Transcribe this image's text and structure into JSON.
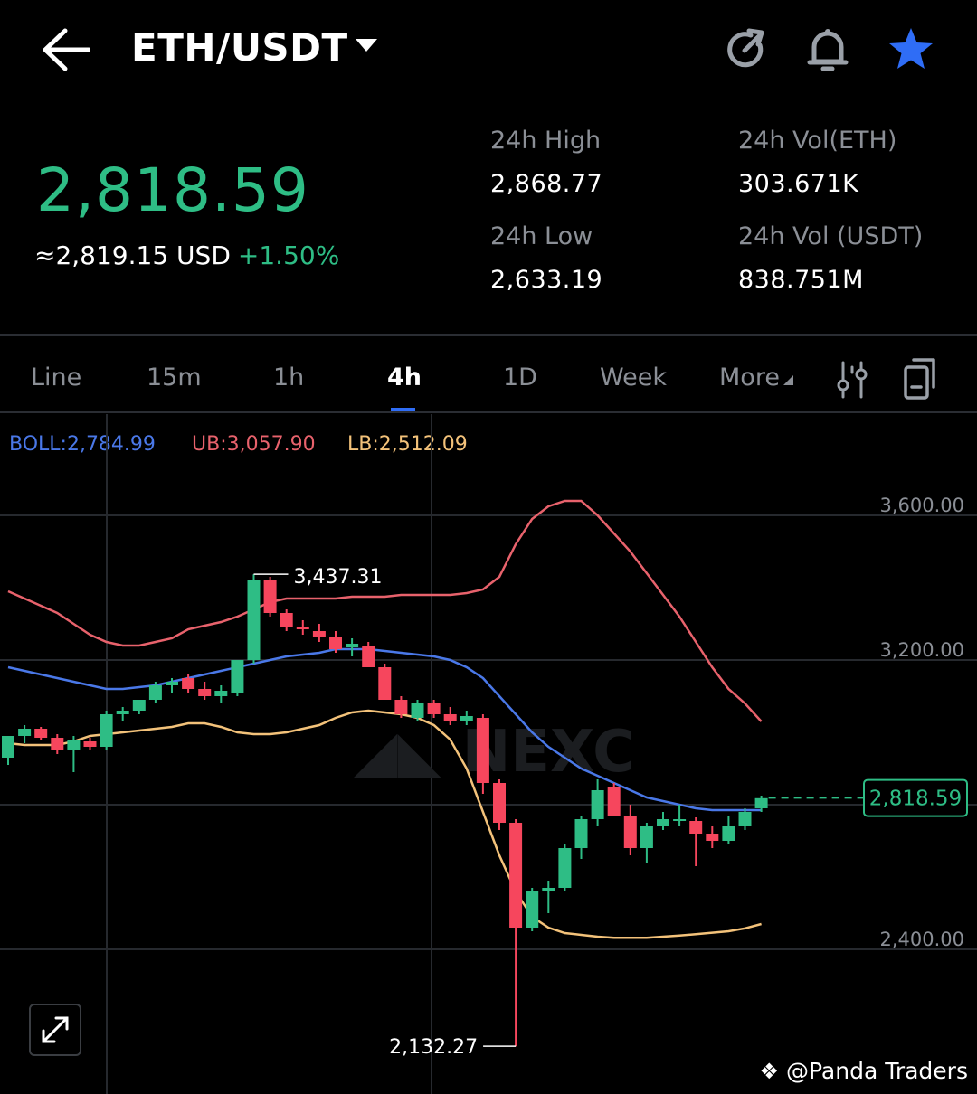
{
  "header": {
    "pair": "ETH/USDT",
    "icons": [
      "back-arrow-icon",
      "refresh-share-icon",
      "bell-icon",
      "star-icon"
    ],
    "star_color": "#2f6df6"
  },
  "ticker": {
    "last_price": "2,818.59",
    "usd_equiv": "≈2,819.15 USD",
    "change_pct": "+1.50%",
    "high_label": "24h High",
    "high_value": "2,868.77",
    "low_label": "24h Low",
    "low_value": "2,633.19",
    "vol_eth_label": "24h Vol(ETH)",
    "vol_eth_value": "303.671K",
    "vol_usdt_label": "24h Vol (USDT)",
    "vol_usdt_value": "838.751M",
    "up_color": "#2ebd85",
    "down_color": "#f6465d"
  },
  "tabs": {
    "items": [
      "Line",
      "15m",
      "1h",
      "4h",
      "1D",
      "Week",
      "More"
    ],
    "active": "4h"
  },
  "indicators": {
    "boll": "BOLL:2,784.99",
    "ub": "UB:3,057.90",
    "lb": "LB:2,512.09",
    "boll_color": "#4a78e8",
    "ub_color": "#e8626c",
    "lb_color": "#f3c27a"
  },
  "chart_data": {
    "type": "candlestick",
    "y_ticks": [
      "3,600.00",
      "3,200.00",
      "2,400.00"
    ],
    "ylim": [
      2100,
      3700
    ],
    "last_price_label": "2,818.59",
    "last_price": 2818.59,
    "high_label": "3,437.31",
    "high_value": 3437.31,
    "low_label": "2,132.27",
    "low_value": 2132.27,
    "candles": [
      [
        2930,
        2990,
        2910,
        2990
      ],
      [
        2990,
        3020,
        2970,
        3010
      ],
      [
        3010,
        3015,
        2980,
        2985
      ],
      [
        2985,
        2995,
        2940,
        2950
      ],
      [
        2950,
        2990,
        2890,
        2980
      ],
      [
        2975,
        2985,
        2950,
        2960
      ],
      [
        2960,
        3060,
        2950,
        3050
      ],
      [
        3050,
        3070,
        3030,
        3060
      ],
      [
        3060,
        3090,
        3050,
        3090
      ],
      [
        3090,
        3140,
        3080,
        3130
      ],
      [
        3130,
        3150,
        3110,
        3140
      ],
      [
        3150,
        3160,
        3110,
        3120
      ],
      [
        3120,
        3140,
        3090,
        3100
      ],
      [
        3100,
        3130,
        3080,
        3115
      ],
      [
        3110,
        3200,
        3100,
        3200
      ],
      [
        3200,
        3437,
        3190,
        3420
      ],
      [
        3420,
        3430,
        3320,
        3330
      ],
      [
        3330,
        3340,
        3280,
        3290
      ],
      [
        3290,
        3310,
        3270,
        3285
      ],
      [
        3280,
        3300,
        3250,
        3265
      ],
      [
        3265,
        3280,
        3220,
        3230
      ],
      [
        3235,
        3260,
        3210,
        3245
      ],
      [
        3240,
        3250,
        3180,
        3180
      ],
      [
        3180,
        3190,
        3090,
        3090
      ],
      [
        3090,
        3100,
        3040,
        3050
      ],
      [
        3040,
        3090,
        3030,
        3080
      ],
      [
        3080,
        3090,
        3040,
        3050
      ],
      [
        3050,
        3070,
        3020,
        3030
      ],
      [
        3030,
        3060,
        3020,
        3045
      ],
      [
        3040,
        3050,
        2830,
        2860
      ],
      [
        2860,
        2870,
        2730,
        2750
      ],
      [
        2750,
        2760,
        2132,
        2460
      ],
      [
        2460,
        2570,
        2450,
        2560
      ],
      [
        2560,
        2590,
        2500,
        2570
      ],
      [
        2570,
        2690,
        2560,
        2680
      ],
      [
        2680,
        2770,
        2650,
        2760
      ],
      [
        2760,
        2870,
        2740,
        2840
      ],
      [
        2850,
        2860,
        2770,
        2770
      ],
      [
        2770,
        2800,
        2660,
        2680
      ],
      [
        2680,
        2750,
        2640,
        2740
      ],
      [
        2740,
        2780,
        2730,
        2760
      ],
      [
        2760,
        2800,
        2740,
        2760
      ],
      [
        2755,
        2765,
        2630,
        2720
      ],
      [
        2720,
        2740,
        2680,
        2700
      ],
      [
        2700,
        2770,
        2690,
        2740
      ],
      [
        2740,
        2790,
        2730,
        2780
      ],
      [
        2790,
        2825,
        2780,
        2818
      ]
    ],
    "series": [
      {
        "name": "UB",
        "values": [
          3390,
          3370,
          3350,
          3330,
          3300,
          3270,
          3250,
          3240,
          3240,
          3250,
          3260,
          3285,
          3295,
          3305,
          3320,
          3340,
          3360,
          3370,
          3370,
          3370,
          3370,
          3375,
          3375,
          3375,
          3380,
          3380,
          3380,
          3380,
          3385,
          3395,
          3430,
          3520,
          3590,
          3625,
          3640,
          3640,
          3600,
          3550,
          3500,
          3440,
          3380,
          3320,
          3250,
          3180,
          3120,
          3080,
          3030
        ]
      },
      {
        "name": "BOLL",
        "values": [
          3180,
          3170,
          3160,
          3150,
          3140,
          3130,
          3120,
          3120,
          3125,
          3130,
          3140,
          3150,
          3160,
          3170,
          3180,
          3190,
          3200,
          3210,
          3215,
          3220,
          3230,
          3230,
          3230,
          3225,
          3220,
          3215,
          3210,
          3200,
          3180,
          3150,
          3100,
          3050,
          3000,
          2960,
          2930,
          2900,
          2880,
          2860,
          2840,
          2820,
          2810,
          2800,
          2790,
          2785,
          2785,
          2785,
          2785
        ]
      },
      {
        "name": "LB",
        "values": [
          2970,
          2965,
          2965,
          2965,
          2975,
          2990,
          2995,
          3000,
          3005,
          3010,
          3015,
          3025,
          3025,
          3015,
          3000,
          2995,
          2995,
          3000,
          3010,
          3020,
          3040,
          3055,
          3060,
          3055,
          3050,
          3040,
          3020,
          2980,
          2900,
          2780,
          2660,
          2560,
          2490,
          2460,
          2445,
          2440,
          2435,
          2432,
          2432,
          2432,
          2435,
          2438,
          2442,
          2446,
          2450,
          2458,
          2470
        ]
      }
    ]
  },
  "watermark": {
    "chart_mark": "NEXC",
    "credit": "@Panda Traders"
  }
}
